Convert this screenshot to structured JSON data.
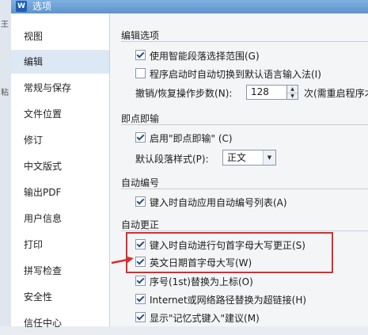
{
  "background": {
    "glyph1": "王",
    "glyph2": "粘"
  },
  "window": {
    "title": "选项",
    "app_icon": "W"
  },
  "sidebar": {
    "items": [
      {
        "label": "视图"
      },
      {
        "label": "编辑"
      },
      {
        "label": "常规与保存"
      },
      {
        "label": "文件位置"
      },
      {
        "label": "修订"
      },
      {
        "label": "中文版式"
      },
      {
        "label": "输出PDF"
      },
      {
        "label": "用户信息"
      },
      {
        "label": "打印"
      },
      {
        "label": "拼写检查"
      },
      {
        "label": "安全性"
      },
      {
        "label": "信任中心"
      }
    ],
    "active": "编辑"
  },
  "sections": {
    "edit": {
      "title": "编辑选项",
      "smart_select": "使用智能段落选择范围(G)",
      "auto_switch_ime": "程序启动时自动切换到默认语言输入法(I)",
      "undo_label": "撤销/恢复操作步数(N):",
      "undo_value": "128",
      "undo_suffix": "次(需重启程序才能"
    },
    "click_type": {
      "title": "即点即输",
      "enable": "启用\"即点即输\" (C)",
      "style_label": "默认段落样式(P):",
      "style_value": "正文"
    },
    "auto_number": {
      "title": "自动编号",
      "apply_list": "键入时自动应用自动编号列表(A)"
    },
    "autocorrect": {
      "title": "自动更正",
      "capitalize_sentence": "键入时自动进行句首字母大写更正(S)",
      "capitalize_date": "英文日期首字母大写(W)",
      "ordinal": "序号(1st)替换为上标(O)",
      "hyperlink": "Internet或网络路径替换为超链接(H)",
      "memory_suggest": "显示\"记忆式键入\"建议(M)"
    }
  },
  "colors": {
    "accent": "#e02b2b",
    "active_nav": "#dde8f5"
  }
}
